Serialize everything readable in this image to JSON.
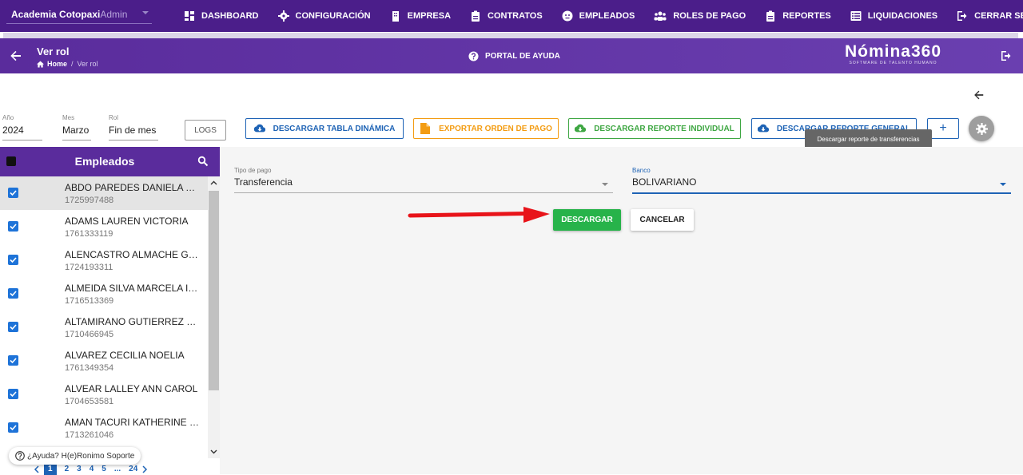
{
  "company": {
    "name": "Academia Cotopaxi",
    "role": "Admin"
  },
  "nav": [
    {
      "label": "DASHBOARD",
      "icon": "dashboard-icon"
    },
    {
      "label": "CONFIGURACIÓN",
      "icon": "gear-icon"
    },
    {
      "label": "EMPRESA",
      "icon": "building-icon"
    },
    {
      "label": "CONTRATOS",
      "icon": "clipboard-icon"
    },
    {
      "label": "EMPLEADOS",
      "icon": "face-icon"
    },
    {
      "label": "ROLES DE PAGO",
      "icon": "people-icon"
    },
    {
      "label": "REPORTES",
      "icon": "clipboard-icon"
    },
    {
      "label": "LIQUIDACIONES",
      "icon": "list-icon"
    },
    {
      "label": "CERRAR SESIÓN",
      "icon": "logout-icon"
    }
  ],
  "header": {
    "title": "Ver rol",
    "breadcrumb_home": "Home",
    "breadcrumb_sep": "/",
    "breadcrumb_current": "Ver rol",
    "portal": "PORTAL DE AYUDA",
    "logo_name": "Nómina360",
    "logo_tag": "SOFTWARE DE TALENTO HUMANO"
  },
  "filters": {
    "year_label": "Año",
    "year_value": "2024",
    "month_label": "Mes",
    "month_value": "Marzo",
    "rol_label": "Rol",
    "rol_value": "Fin de mes"
  },
  "toolbar": {
    "logs": "LOGS",
    "tabla": "DESCARGAR TABLA DINÁMICA",
    "orden": "EXPORTAR ORDEN DE PAGO",
    "individual": "DESCARGAR REPORTE INDIVIDUAL",
    "general": "DESCARGAR REPORTE GENERAL",
    "plus": "+",
    "tooltip": "Descargar reporte de transferencias"
  },
  "sidebar": {
    "title": "Empleados",
    "employees": [
      {
        "name": "ABDO PAREDES DANIELA CA...",
        "id": "1725997488"
      },
      {
        "name": "ADAMS LAUREN VICTORIA",
        "id": "1761333119"
      },
      {
        "name": "ALENCASTRO ALMACHE GA...",
        "id": "1724193311"
      },
      {
        "name": "ALMEIDA SILVA MARCELA IS...",
        "id": "1716513369"
      },
      {
        "name": "ALTAMIRANO GUTIERREZ GL...",
        "id": "1710466945"
      },
      {
        "name": "ALVAREZ CECILIA NOELIA",
        "id": "1761349354"
      },
      {
        "name": "ALVEAR LALLEY ANN CAROL",
        "id": "1704653581"
      },
      {
        "name": "AMAN TACURI KATHERINE E...",
        "id": "1713261046"
      }
    ],
    "pages": [
      "1",
      "2",
      "3",
      "4",
      "5",
      "...",
      "24"
    ],
    "help": "¿Ayuda? H(e)Ronimo Soporte"
  },
  "form": {
    "tipo_label": "Tipo de pago",
    "tipo_value": "Transferencia",
    "banco_label": "Banco",
    "banco_value": "BOLIVARIANO",
    "descargar": "DESCARGAR",
    "cancelar": "CANCELAR"
  },
  "colors": {
    "brand": "#4b1e8a",
    "primary": "#1e63b5",
    "success": "#27b34a",
    "warning": "#f39c12",
    "arrow": "#e8141a"
  }
}
